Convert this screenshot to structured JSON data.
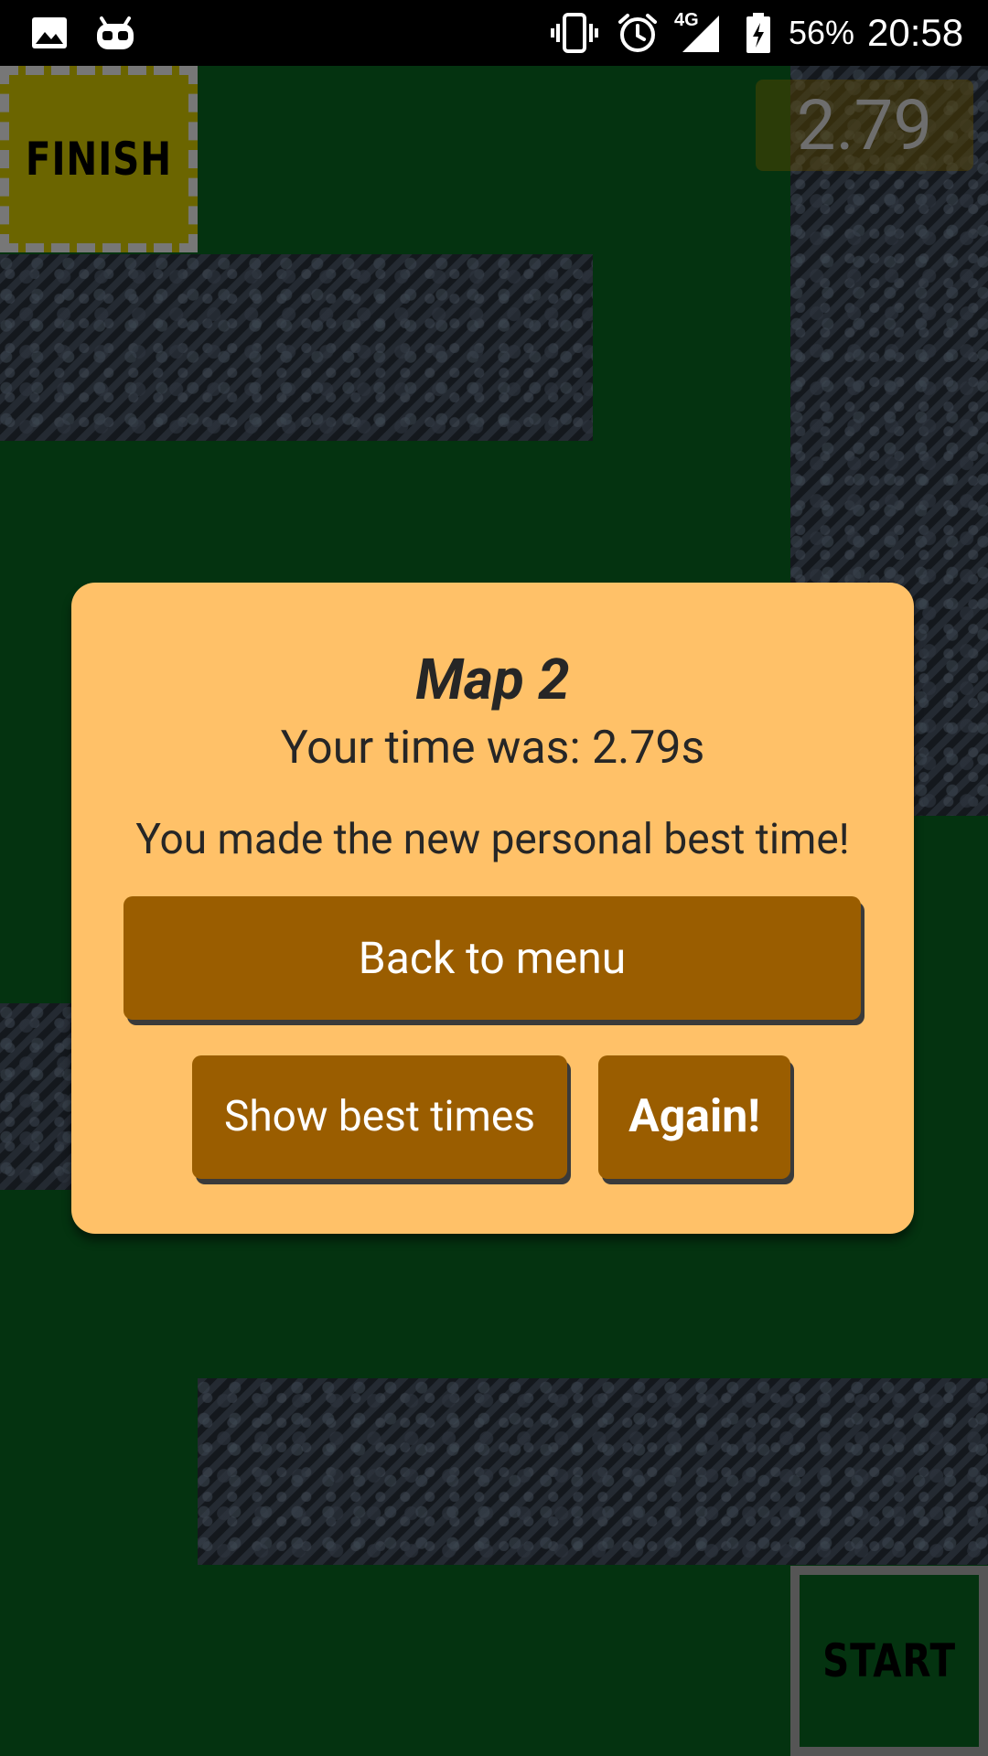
{
  "status_bar": {
    "icons_left": [
      "gallery-icon",
      "android-robot-icon"
    ],
    "icons_right": [
      "vibrate-icon",
      "alarm-icon",
      "network-4g-icon",
      "battery-charging-icon"
    ],
    "network_label": "4G",
    "battery": "56%",
    "time": "20:58"
  },
  "game": {
    "timer": "2.79",
    "finish_label": "FINISH",
    "start_label": "START",
    "colors": {
      "floor": "#043310",
      "finish_pad": "#6b6500",
      "dialog": "#ffc168",
      "button": "#9a5d00"
    }
  },
  "dialog": {
    "title": "Map 2",
    "time_text": "Your time was: 2.79s",
    "message": "You made the new personal best time!",
    "back_button": "Back to menu",
    "best_button": "Show best times",
    "again_button": "Again!"
  }
}
